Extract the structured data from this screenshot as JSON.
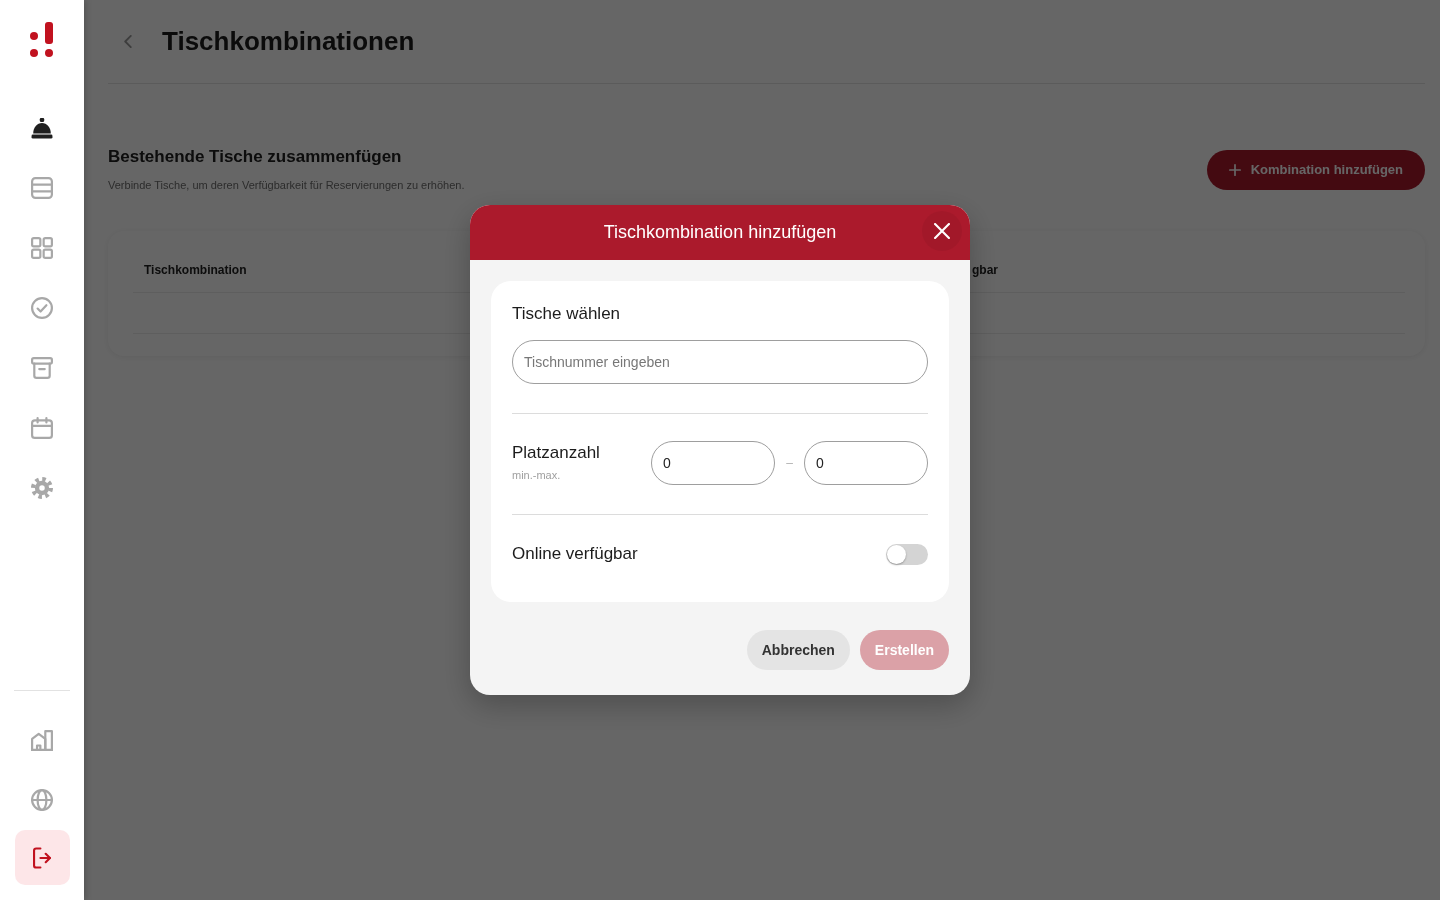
{
  "sidebar": {
    "nav_items": [
      {
        "selected": true
      },
      {
        "selected": false
      },
      {
        "selected": false
      },
      {
        "selected": false
      },
      {
        "selected": false
      },
      {
        "selected": false
      },
      {
        "selected": false
      }
    ],
    "bottom_items": [
      {
        "selected": false
      },
      {
        "selected": false
      }
    ]
  },
  "page": {
    "title": "Tischkombinationen",
    "section_title": "Bestehende Tische zusammenfügen",
    "section_subtitle": "Verbinde Tische, um deren Verfügbarkeit für Reservierungen zu erhöhen.",
    "add_button": "Kombination hinzufügen",
    "table": {
      "columns": [
        "Tischkombination",
        "gbar"
      ]
    }
  },
  "dialog": {
    "title": "Tischkombination hinzufügen",
    "tables": {
      "label": "Tische wählen",
      "placeholder": "Tischnummer eingeben"
    },
    "seats": {
      "label": "Platzanzahl",
      "hint": "min.-max.",
      "min": "0",
      "separator": "–",
      "max": "0"
    },
    "online": {
      "label": "Online verfügbar",
      "on": false
    },
    "buttons": [
      {
        "label": "Abbrechen",
        "kind": "secondary",
        "disabled": false
      },
      {
        "label": "Erstellen",
        "kind": "primary",
        "disabled": true
      }
    ]
  }
}
